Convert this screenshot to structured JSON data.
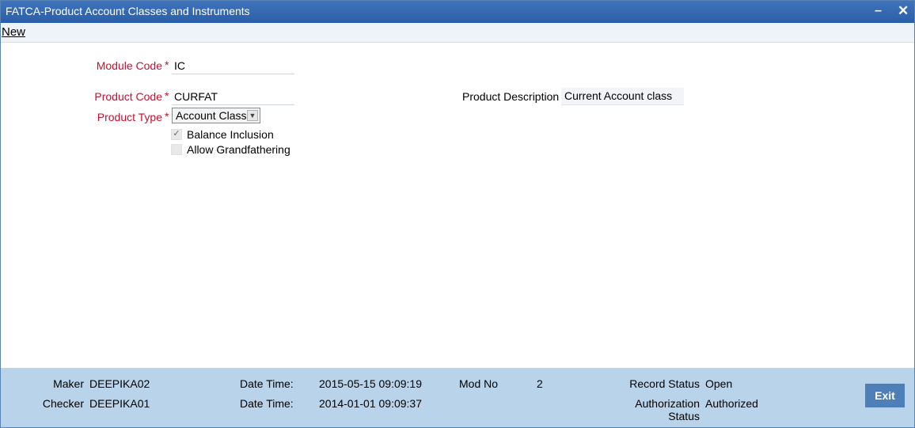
{
  "window": {
    "title": "FATCA-Product Account Classes and Instruments",
    "minimize_symbol": "–",
    "close_symbol": "✕"
  },
  "menu": {
    "new_label": "New"
  },
  "form": {
    "required_mark": "*",
    "module_code": {
      "label": "Module Code",
      "value": "IC"
    },
    "product_code": {
      "label": "Product Code",
      "value": "CURFAT"
    },
    "product_type": {
      "label": "Product Type",
      "selected": "Account Class",
      "arrow_icon": "chevron-down-icon"
    },
    "balance_inclusion": {
      "label": "Balance Inclusion",
      "checked": true
    },
    "allow_grandfathering": {
      "label": "Allow Grandfathering",
      "checked": false
    },
    "product_description": {
      "label": "Product Description",
      "value": "Current Account class"
    }
  },
  "footer": {
    "maker_label": "Maker",
    "maker_value": "DEEPIKA02",
    "checker_label": "Checker",
    "checker_value": "DEEPIKA01",
    "date_time_label": "Date Time:",
    "maker_date_time": "2015-05-15 09:09:19",
    "checker_date_time": "2014-01-01 09:09:37",
    "mod_no_label": "Mod No",
    "mod_no_value": "2",
    "record_status_label": "Record Status",
    "record_status_value": "Open",
    "auth_status_label_1": "Authorization",
    "auth_status_label_2": "Status",
    "auth_status_value": "Authorized",
    "exit_label": "Exit"
  },
  "colors": {
    "titlebar": "#2f66b0",
    "required_label": "#c8102e",
    "footer_bg": "#b9d3ea",
    "exit_button": "#4f7fb8"
  }
}
